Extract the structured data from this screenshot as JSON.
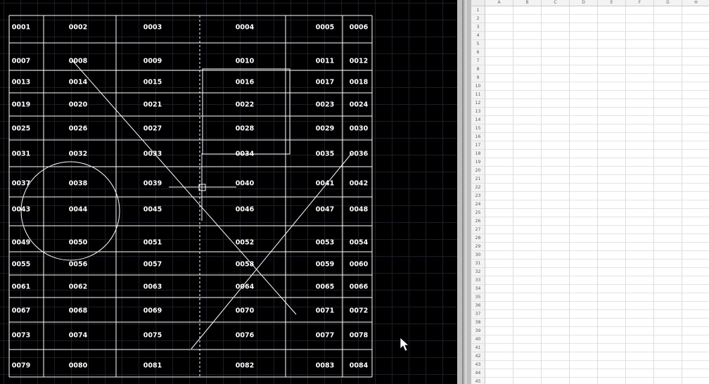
{
  "cad": {
    "cells": [
      [
        "0001",
        "0002",
        "0003",
        "0004",
        "0005",
        "0006"
      ],
      [
        "0007",
        "0008",
        "0009",
        "0010",
        "0011",
        "0012"
      ],
      [
        "0013",
        "0014",
        "0015",
        "0016",
        "0017",
        "0018"
      ],
      [
        "0019",
        "0020",
        "0021",
        "0022",
        "0023",
        "0024"
      ],
      [
        "0025",
        "0026",
        "0027",
        "0028",
        "0029",
        "0030"
      ],
      [
        "0031",
        "0032",
        "0033",
        "0034",
        "0035",
        "0036"
      ],
      [
        "0037",
        "0038",
        "0039",
        "0040",
        "0041",
        "0042"
      ],
      [
        "0043",
        "0044",
        "0045",
        "0046",
        "0047",
        "0048"
      ],
      [
        "0049",
        "0050",
        "0051",
        "0052",
        "0053",
        "0054"
      ],
      [
        "0055",
        "0056",
        "0057",
        "0058",
        "0059",
        "0060"
      ],
      [
        "0061",
        "0062",
        "0063",
        "0064",
        "0065",
        "0066"
      ],
      [
        "0067",
        "0068",
        "0069",
        "0070",
        "0071",
        "0072"
      ],
      [
        "0073",
        "0074",
        "0075",
        "0076",
        "0077",
        "0078"
      ],
      [
        "0079",
        "0080",
        "0081",
        "0082",
        "0083",
        "0084"
      ]
    ],
    "colors": {
      "background": "#000000",
      "lines": "#ffffff",
      "grid": "#1b1e26"
    }
  },
  "sheet": {
    "columns": [
      "A",
      "B",
      "C",
      "D",
      "E",
      "F",
      "G",
      "H"
    ],
    "rows": [
      "1",
      "2",
      "3",
      "4",
      "5",
      "6",
      "7",
      "8",
      "9",
      "10",
      "11",
      "12",
      "13",
      "14",
      "15",
      "16",
      "17",
      "18",
      "19",
      "20",
      "21",
      "22",
      "23",
      "24",
      "25",
      "26",
      "27",
      "28",
      "29",
      "30",
      "31",
      "32",
      "33",
      "34",
      "35",
      "36",
      "37",
      "38",
      "39",
      "40",
      "41",
      "42",
      "43",
      "44",
      "45"
    ]
  }
}
